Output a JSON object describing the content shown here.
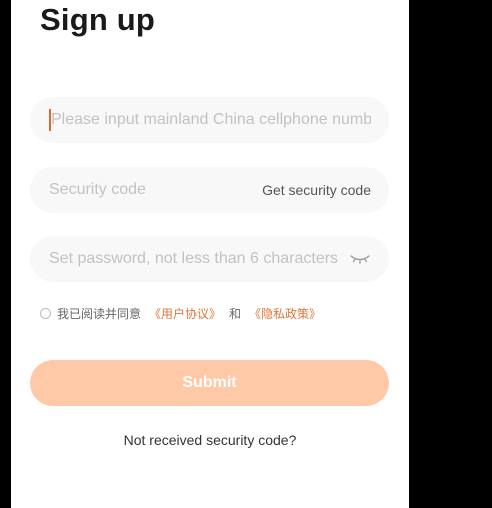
{
  "page": {
    "title": "Sign up"
  },
  "form": {
    "phone_placeholder": "Please input mainland China cellphone number",
    "phone_value": "",
    "code_placeholder": "Security code",
    "code_value": "",
    "get_code_label": "Get security code",
    "password_placeholder": "Set password, not less than 6 characters",
    "password_value": "",
    "password_toggle_icon": "eye-closed-icon"
  },
  "agreement": {
    "prefix": "我已阅读并同意",
    "user_agreement": "《用户协议》",
    "conjunction": "和",
    "privacy_policy": "《隐私政策》",
    "checked": false
  },
  "actions": {
    "submit_label": "Submit",
    "resend_label": "Not received security code?"
  },
  "colors": {
    "background_outer": "#000000",
    "screen": "#ffffff",
    "field_bg": "#f8f8f8",
    "placeholder": "#c2c2c2",
    "accent_link": "#d9783a",
    "caret": "#e0662a",
    "submit_disabled": "#ffc9a8"
  }
}
